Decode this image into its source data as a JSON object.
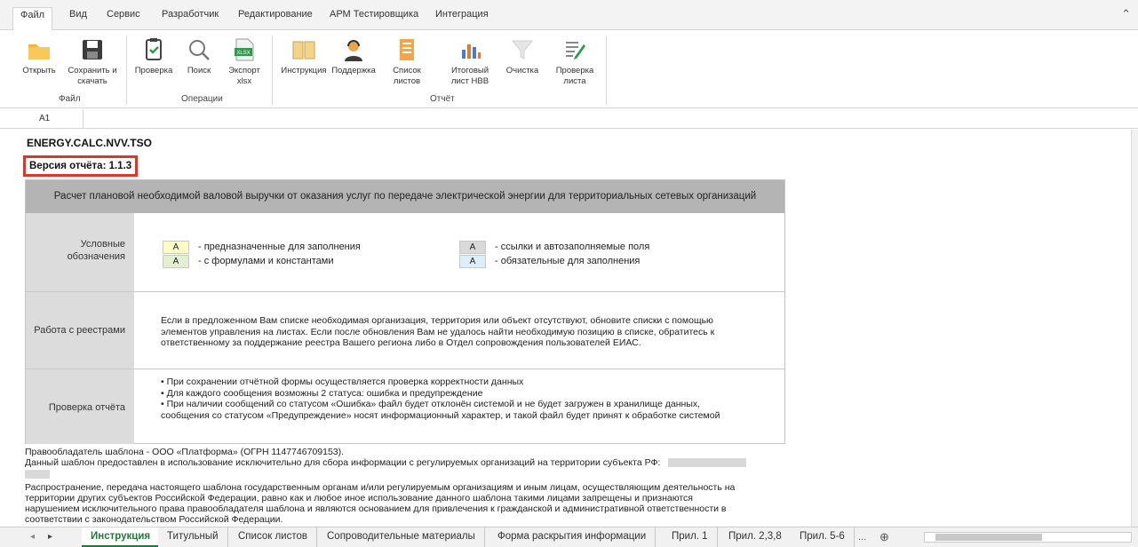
{
  "ribbon_tabs": [
    "Файл",
    "Вид",
    "Сервис",
    "Разработчик",
    "Редактирование",
    "АРМ Тестировщика",
    "Интеграция"
  ],
  "ribbon": {
    "groups": [
      {
        "label": "Файл",
        "buttons": [
          {
            "label": "Открыть",
            "icon": "folder-icon"
          },
          {
            "label": "Сохранить и скачать",
            "icon": "save-icon"
          }
        ]
      },
      {
        "label": "Операции",
        "buttons": [
          {
            "label": "Проверка",
            "icon": "check-icon"
          },
          {
            "label": "Поиск",
            "icon": "search-icon"
          },
          {
            "label": "Экспорт xlsx",
            "icon": "xlsx-icon"
          }
        ]
      },
      {
        "label": "Отчёт",
        "buttons": [
          {
            "label": "Инструкция",
            "icon": "book-icon"
          },
          {
            "label": "Поддержка",
            "icon": "support-icon"
          },
          {
            "label": "Список листов",
            "icon": "sheets-list-icon"
          },
          {
            "label": "Итоговый лист НВВ",
            "icon": "chart-icon"
          },
          {
            "label": "Очистка",
            "icon": "filter-clear-icon"
          },
          {
            "label": "Проверка листа",
            "icon": "sheet-check-icon"
          }
        ]
      }
    ]
  },
  "formula_bar": {
    "cell_ref": "A1"
  },
  "sheet": {
    "code": "ENERGY.CALC.NVV.TSO",
    "version_label": "Версия отчёта: 1.1.3",
    "header": "Расчет плановой необходимой валовой выручки от оказания услуг по передаче электрической энергии для территориальных сетевых организаций",
    "legend_label": "Условные обозначения",
    "legend": [
      {
        "sample": "A",
        "text": "- предназначенные для заполнения",
        "color": "#fffbc8"
      },
      {
        "sample": "A",
        "text": "- с формулами и константами",
        "color": "#e2efd0"
      },
      {
        "sample": "A",
        "text": "- ссылки и автозаполняемые поля",
        "color": "#d9d9d9"
      },
      {
        "sample": "A",
        "text": "- обязательные для заполнения",
        "color": "#ddeef8"
      }
    ],
    "registries_label": "Работа с реестрами",
    "registries_text": [
      "Если в предложенном Вам списке необходимая организация, территория или объект отсутствуют, обновите списки с помощью",
      "элементов управления на листах. Если после обновления Вам не удалось найти необходимую позицию в списке, обратитесь к",
      "ответственному за поддержание реестра Вашего региона либо в Отдел сопровождения пользователей ЕИАС."
    ],
    "check_label": "Проверка отчёта",
    "check_text": [
      "• При сохранении отчётной формы осуществляется проверка корректности данных",
      "• Для каждого сообщения возможны 2 статуса: ошибка и предупреждение",
      "• При наличии сообщений со статусом «Ошибка» файл будет отклонён системой и не будет загружен в хранилище данных,",
      "сообщения со статусом «Предупреждение» носят информационный характер, и такой файл будет принят к обработке системой"
    ],
    "footer": [
      "Правообладатель шаблона - ООО «Платформа» (ОГРН 1147746709153).",
      "Данный шаблон предоставлен в использование исключительно для сбора информации с регулируемых организаций на территории субъекта РФ:",
      "Распространение, передача настоящего шаблона государственным органам и/или регулируемым организациям и иным лицам, осуществляющим деятельность на",
      "территории других субъектов Российской Федерации, равно как и любое иное использование данного шаблона такими лицами запрещены и признаются",
      "нарушением исключительного права правообладателя шаблона и являются основанием для привлечения к гражданской и административной ответственности в",
      "соответствии с законодательством Российской Федерации."
    ]
  },
  "sheet_tabs": [
    "Инструкция",
    "Титульный",
    "Список листов",
    "Сопроводительные материалы",
    "Форма раскрытия информации",
    "Прил. 1",
    "Прил. 2,3,8",
    "Прил. 5-6"
  ],
  "sheet_tab_extras": {
    "more": "...",
    "add": "⊕"
  },
  "colors": {
    "accent_green": "#1f7a3a",
    "highlight_red": "#d63a2f",
    "header_gray": "#b4b4b4",
    "label_gray": "#dcdcdc"
  }
}
